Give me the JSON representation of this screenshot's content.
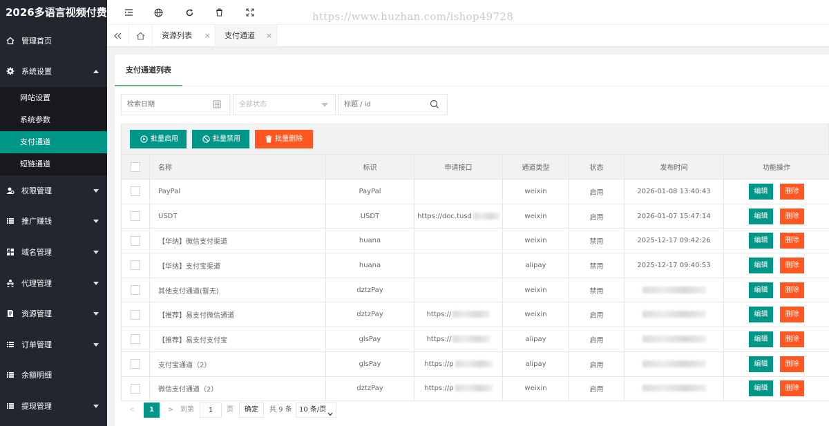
{
  "app": {
    "logo": "2026多语言视频付费",
    "watermark": "https://www.huzhan.com/ishop49728"
  },
  "sidebar": {
    "items": [
      {
        "label": "管理首页",
        "icon": "home-icon"
      },
      {
        "label": "系统设置",
        "icon": "gear-icon",
        "expanded": true,
        "children": [
          {
            "label": "网站设置"
          },
          {
            "label": "系统参数"
          },
          {
            "label": "支付通道",
            "active": true
          },
          {
            "label": "短链通道"
          }
        ]
      },
      {
        "label": "权限管理",
        "icon": "users-icon"
      },
      {
        "label": "推广赚钱",
        "icon": "list-icon"
      },
      {
        "label": "域名管理",
        "icon": "grid-icon"
      },
      {
        "label": "代理管理",
        "icon": "group-icon"
      },
      {
        "label": "资源管理",
        "icon": "file-icon"
      },
      {
        "label": "订单管理",
        "icon": "list-icon"
      },
      {
        "label": "余额明细",
        "icon": "list-icon"
      },
      {
        "label": "提现管理",
        "icon": "list-icon"
      }
    ]
  },
  "header": {
    "icons": [
      "menu-fold-icon",
      "globe-icon",
      "refresh-icon",
      "trash-icon",
      "fullscreen-icon"
    ]
  },
  "tabs": [
    {
      "label": "资源列表",
      "close": "×"
    },
    {
      "label": "支付通道",
      "close": "×",
      "active": true
    }
  ],
  "card": {
    "tab_label": "支付通道列表"
  },
  "filters": {
    "date_placeholder": "检索日期",
    "status_placeholder": "全部状态",
    "keyword_placeholder": "标题 / id"
  },
  "toolbar": {
    "enable_label": "批量启用",
    "disable_label": "批量禁用",
    "delete_label": "批量删除",
    "colors": {
      "green": "#009688",
      "orange": "#ff5722"
    }
  },
  "table": {
    "headers": [
      "名称",
      "标识",
      "申请接口",
      "通道类型",
      "状态",
      "发布时间",
      "功能操作"
    ],
    "edit_label": "编辑",
    "delete_label": "删除",
    "rows": [
      {
        "name": "PayPal",
        "code": "PayPal",
        "api": "",
        "type": "weixin",
        "status": "启用",
        "time": "2026-01-08 13:40:43"
      },
      {
        "name": "USDT",
        "code": "USDT",
        "api": "https://doc.tusd",
        "type": "weixin",
        "status": "启用",
        "time": "2026-01-07 15:47:14"
      },
      {
        "name": "【华纳】微信支付渠道",
        "code": "huana",
        "api": "",
        "type": "weixin",
        "status": "禁用",
        "time": "2025-12-17 09:42:26"
      },
      {
        "name": "【华纳】支付宝渠道",
        "code": "huana",
        "api": "",
        "type": "alipay",
        "status": "禁用",
        "time": "2025-12-17 09:40:53"
      },
      {
        "name": "其他支付通道(暂无)",
        "code": "dztzPay",
        "api": "",
        "type": "weixin",
        "status": "禁用",
        "time": ""
      },
      {
        "name": "【推荐】易支付微信通道",
        "code": "dztzPay",
        "api": "https://",
        "type": "weixin",
        "status": "启用",
        "time": ""
      },
      {
        "name": "【推荐】易支付支付宝",
        "code": "glsPay",
        "api": "https://",
        "type": "alipay",
        "status": "启用",
        "time": ""
      },
      {
        "name": "支付宝通道（2）",
        "code": "glsPay",
        "api": "https://p",
        "type": "alipay",
        "status": "启用",
        "time": ""
      },
      {
        "name": "微信支付通道（2）",
        "code": "dztzPay",
        "api": "https://p",
        "type": "weixin",
        "status": "启用",
        "time": ""
      }
    ]
  },
  "pager": {
    "prev": "<",
    "current": "1",
    "next": ">",
    "goto_label": "到第",
    "goto_value": "1",
    "page_unit": "页",
    "confirm_label": "确定",
    "total_label": "共 9 条",
    "page_size": "10 条/页"
  }
}
